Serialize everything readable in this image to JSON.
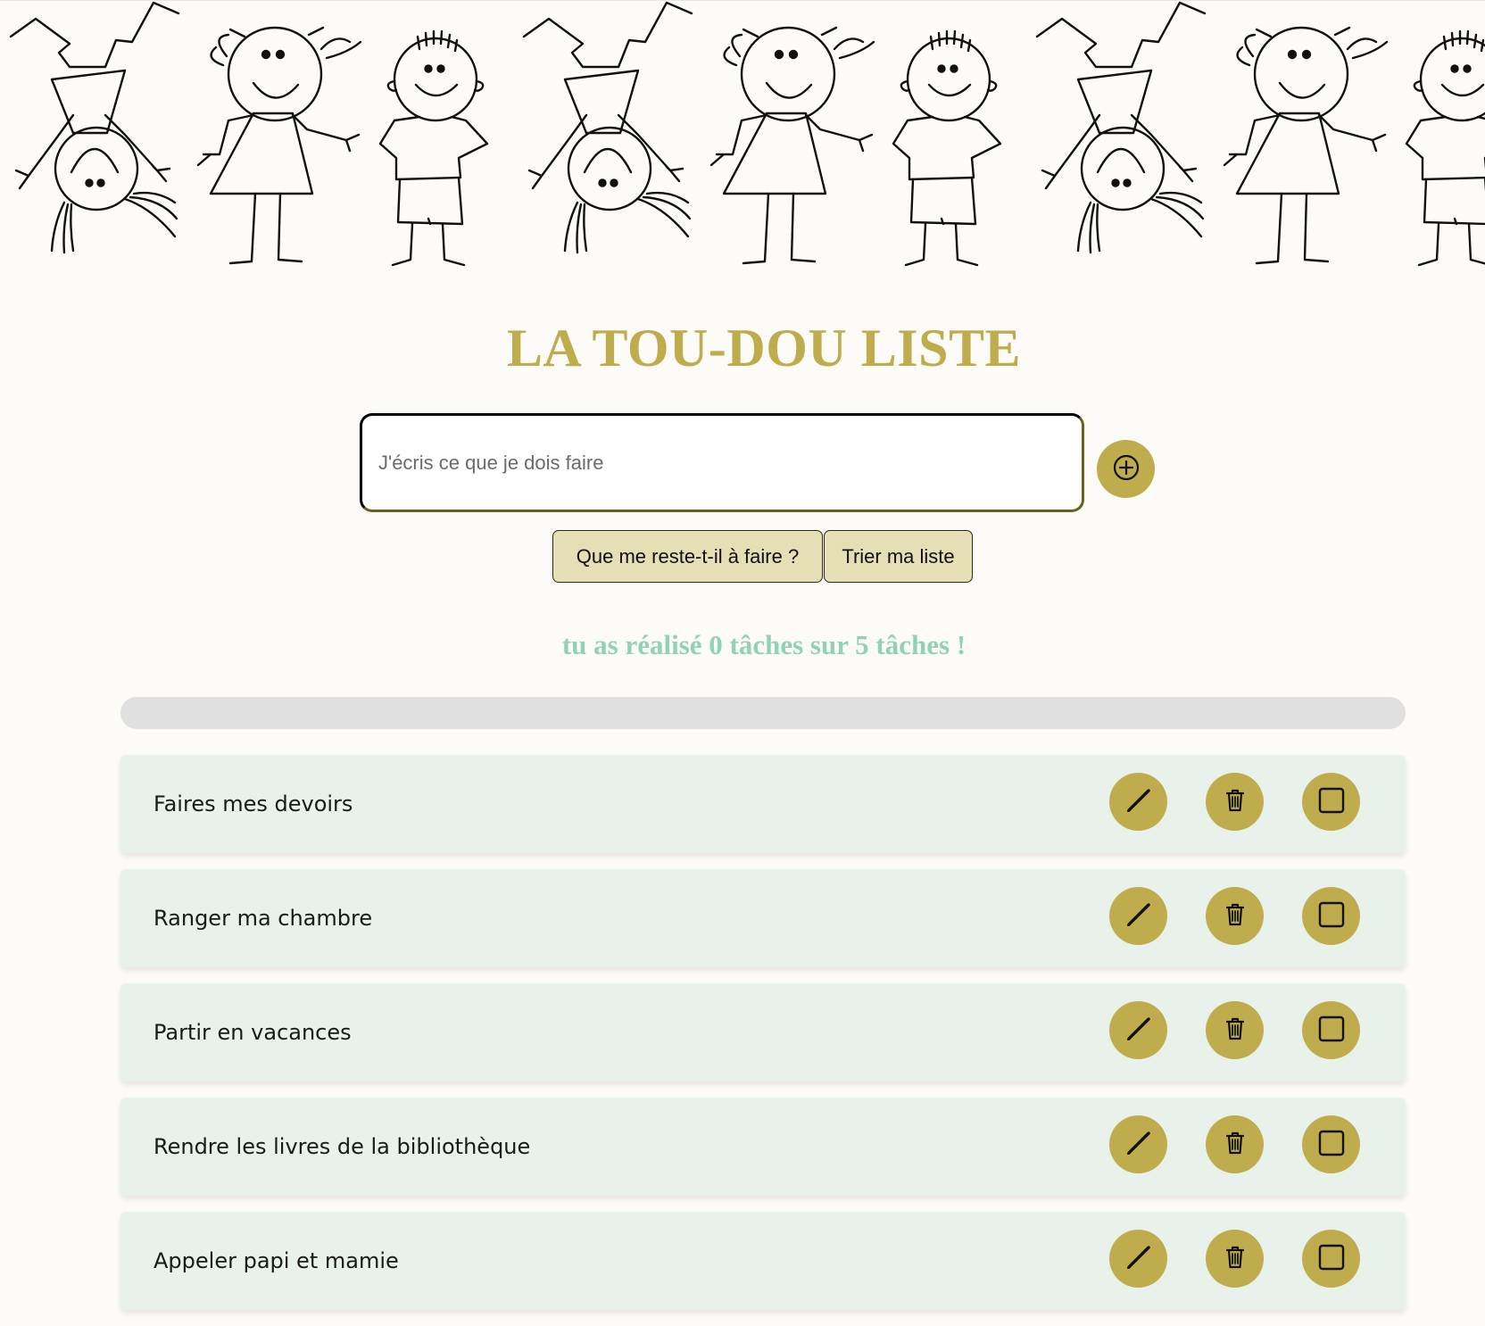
{
  "app": {
    "title": "LA TOU-DOU LISTE"
  },
  "banner": {
    "image": "children-stick-figures-drawing"
  },
  "new_task": {
    "placeholder": "J'écris ce que je dois faire",
    "value": "",
    "add_icon": "plus-circle-icon"
  },
  "actions": {
    "remaining_label": "Que me reste-t-il à faire ?",
    "sort_label": "Trier ma liste"
  },
  "progress": {
    "text": "tu as réalisé 0 tâches sur 5 tâches !",
    "done": 0,
    "total": 5,
    "fraction": 0
  },
  "tasks": [
    {
      "label": "Faires mes devoirs",
      "done": false
    },
    {
      "label": "Ranger ma chambre",
      "done": false
    },
    {
      "label": "Partir en vacances",
      "done": false
    },
    {
      "label": "Rendre les livres de la bibliothèque",
      "done": false
    },
    {
      "label": "Appeler papi et mamie",
      "done": false
    }
  ],
  "icons": {
    "edit": "pencil-icon",
    "delete": "trash-icon",
    "check": "checkbox-empty-icon"
  },
  "colors": {
    "accent": "#bfac4c",
    "button_bg": "#e4dfb5",
    "progress_text": "#8fd3b2",
    "task_bg": "#e8f2ea",
    "page_bg": "#fcfbf7",
    "track": "#e0e0e0"
  }
}
